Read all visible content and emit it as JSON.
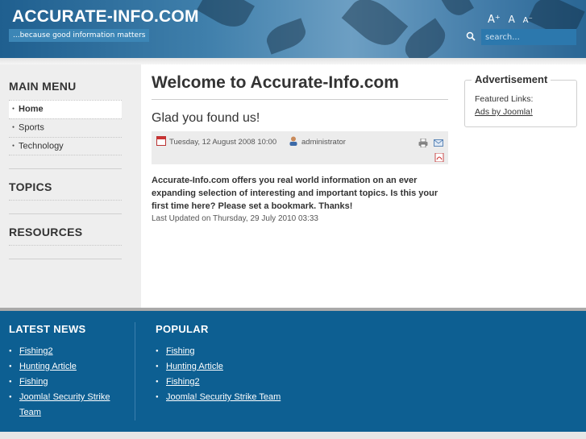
{
  "header": {
    "site_title": "ACCURATE-INFO.COM",
    "tagline": "...because good information matters",
    "font_tools": [
      "A⁺",
      "A",
      "A⁻"
    ],
    "search_placeholder": "search..."
  },
  "sidebar": {
    "main_menu_heading": "MAIN MENU",
    "menu_items": [
      {
        "label": "Home",
        "active": true
      },
      {
        "label": "Sports",
        "active": false
      },
      {
        "label": "Technology",
        "active": false
      }
    ],
    "topics_heading": "TOPICS",
    "resources_heading": "RESOURCES"
  },
  "main": {
    "page_title": "Welcome to Accurate-Info.com",
    "article_title": "Glad you found us!",
    "date": "Tuesday, 12 August 2008 10:00",
    "author": "administrator",
    "body": "Accurate-Info.com offers you real world information on an ever expanding selection of interesting and important topics. Is this your first time here? Please set a bookmark. Thanks!",
    "last_updated": "Last Updated on Thursday, 29 July 2010 03:33"
  },
  "advert": {
    "title": "Advertisement",
    "text": "Featured Links:",
    "link": "Ads by Joomla!"
  },
  "footer": {
    "latest_news_heading": "LATEST NEWS",
    "latest_news": [
      "Fishing2",
      "Hunting Article",
      "Fishing",
      "Joomla! Security Strike Team"
    ],
    "popular_heading": "POPULAR",
    "popular": [
      "Fishing",
      "Hunting Article",
      "Fishing2",
      "Joomla! Security Strike Team"
    ]
  }
}
